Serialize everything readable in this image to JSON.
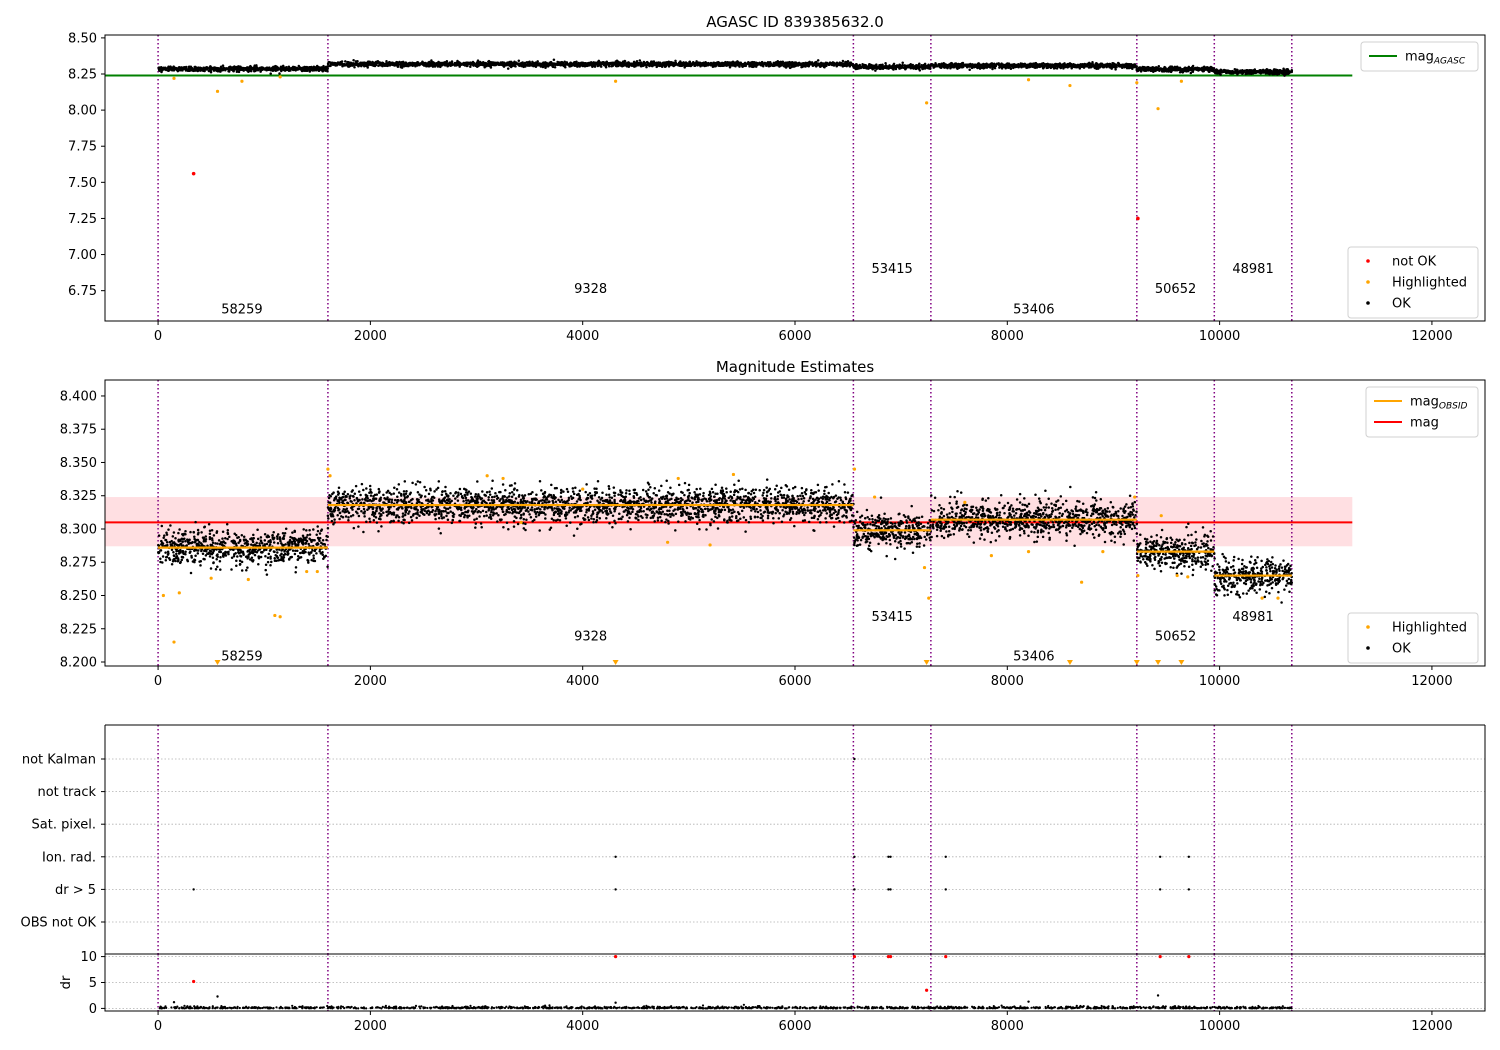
{
  "figure": {
    "title_top": "AGASC ID 839385632.0",
    "title_middle": "Magnitude Estimates"
  },
  "colors": {
    "ok": "#000000",
    "highlighted": "#ffa500",
    "not_ok": "#ff0000",
    "mag_agasc": "#008000",
    "mag": "#ff0000",
    "mag_obsid": "#ffa500",
    "band": "#ffc0c5",
    "obs_boundary": "#800080",
    "grid": "#b0b0b0"
  },
  "legends": {
    "top_upper": [
      {
        "label": "mag",
        "sub": "AGASC",
        "kind": "line",
        "color_key": "mag_agasc"
      }
    ],
    "top_lower": [
      {
        "label": "not OK",
        "kind": "dot",
        "color_key": "not_ok"
      },
      {
        "label": "Highlighted",
        "kind": "dot",
        "color_key": "highlighted"
      },
      {
        "label": "OK",
        "kind": "dot",
        "color_key": "ok"
      }
    ],
    "middle_upper": [
      {
        "label": "mag",
        "sub": "OBSID",
        "kind": "line",
        "color_key": "mag_obsid"
      },
      {
        "label": "mag",
        "sub": "",
        "kind": "line",
        "color_key": "mag"
      }
    ],
    "middle_lower": [
      {
        "label": "Highlighted",
        "kind": "dot",
        "color_key": "highlighted"
      },
      {
        "label": "OK",
        "kind": "dot",
        "color_key": "ok"
      }
    ]
  },
  "chart_data": [
    {
      "panel": "top",
      "type": "scatter",
      "title": "AGASC ID 839385632.0",
      "xlim": [
        -500,
        12500
      ],
      "ylim": [
        6.54,
        8.52
      ],
      "x_ticks": [
        0,
        2000,
        4000,
        6000,
        8000,
        10000,
        12000
      ],
      "x_tick_labels": [
        "0",
        "2000",
        "4000",
        "6000",
        "8000",
        "10000",
        "12000"
      ],
      "y_ticks": [
        6.75,
        7.0,
        7.25,
        7.5,
        7.75,
        8.0,
        8.25,
        8.5
      ],
      "y_tick_labels": [
        "6.75",
        "7.00",
        "7.25",
        "7.50",
        "7.75",
        "8.00",
        "8.25",
        "8.50"
      ],
      "obs_boundaries": [
        0,
        1600,
        6550,
        7280,
        9220,
        9950,
        10680
      ],
      "observations": [
        {
          "obsid": "58259",
          "x_start": 0,
          "x_end": 1600,
          "mag": 8.286,
          "label_x": 790,
          "label_y": 6.62
        },
        {
          "obsid": "9328",
          "x_start": 1600,
          "x_end": 6550,
          "mag": 8.318,
          "label_x": 4075,
          "label_y": 6.76
        },
        {
          "obsid": "53415",
          "x_start": 6550,
          "x_end": 7280,
          "mag": 8.299,
          "label_x": 6915,
          "label_y": 6.9
        },
        {
          "obsid": "53406",
          "x_start": 7280,
          "x_end": 9220,
          "mag": 8.307,
          "label_x": 8250,
          "label_y": 6.62
        },
        {
          "obsid": "50652",
          "x_start": 9220,
          "x_end": 9950,
          "mag": 8.283,
          "label_x": 9585,
          "label_y": 6.76
        },
        {
          "obsid": "48981",
          "x_start": 9950,
          "x_end": 10680,
          "mag": 8.265,
          "label_x": 10315,
          "label_y": 6.9
        }
      ],
      "mag_agasc": {
        "value": 8.24,
        "x_range": [
          -500,
          11250
        ]
      },
      "highlighted_points": [
        [
          150,
          8.22
        ],
        [
          560,
          8.13
        ],
        [
          790,
          8.2
        ],
        [
          1150,
          8.23
        ],
        [
          4310,
          8.2
        ],
        [
          7240,
          8.05
        ],
        [
          8200,
          8.21
        ],
        [
          8590,
          8.17
        ],
        [
          9220,
          8.19
        ],
        [
          9420,
          8.01
        ],
        [
          9640,
          8.2
        ]
      ],
      "not_ok_points": [
        [
          335,
          7.56
        ],
        [
          9230,
          7.25
        ]
      ]
    },
    {
      "panel": "middle",
      "type": "scatter",
      "title": "Magnitude Estimates",
      "xlim": [
        -500,
        12500
      ],
      "ylim": [
        8.197,
        8.412
      ],
      "x_ticks": [
        0,
        2000,
        4000,
        6000,
        8000,
        10000,
        12000
      ],
      "x_tick_labels": [
        "0",
        "2000",
        "4000",
        "6000",
        "8000",
        "10000",
        "12000"
      ],
      "y_ticks": [
        8.2,
        8.225,
        8.25,
        8.275,
        8.3,
        8.325,
        8.35,
        8.375,
        8.4
      ],
      "y_tick_labels": [
        "8.200",
        "8.225",
        "8.250",
        "8.275",
        "8.300",
        "8.325",
        "8.350",
        "8.375",
        "8.400"
      ],
      "obs_boundaries": [
        0,
        1600,
        6550,
        7280,
        9220,
        9950,
        10680
      ],
      "observations": [
        {
          "obsid": "58259",
          "x_start": 0,
          "x_end": 1600,
          "mag": 8.286,
          "spread": 0.0065,
          "label_x": 790,
          "label_y": 8.204
        },
        {
          "obsid": "9328",
          "x_start": 1600,
          "x_end": 6550,
          "mag": 8.318,
          "spread": 0.0065,
          "label_x": 4075,
          "label_y": 8.219
        },
        {
          "obsid": "53415",
          "x_start": 6550,
          "x_end": 7280,
          "mag": 8.299,
          "spread": 0.0065,
          "label_x": 6915,
          "label_y": 8.234
        },
        {
          "obsid": "53406",
          "x_start": 7280,
          "x_end": 9220,
          "mag": 8.307,
          "spread": 0.0065,
          "label_x": 8250,
          "label_y": 8.204
        },
        {
          "obsid": "50652",
          "x_start": 9220,
          "x_end": 9950,
          "mag": 8.283,
          "spread": 0.0065,
          "label_x": 9585,
          "label_y": 8.219
        },
        {
          "obsid": "48981",
          "x_start": 9950,
          "x_end": 10680,
          "mag": 8.265,
          "spread": 0.0065,
          "label_x": 10315,
          "label_y": 8.234
        }
      ],
      "mag": {
        "value": 8.305,
        "band": [
          8.287,
          8.324
        ],
        "x_range": [
          -500,
          11250
        ]
      },
      "highlighted_points": [
        [
          50,
          8.25
        ],
        [
          150,
          8.215
        ],
        [
          200,
          8.252
        ],
        [
          500,
          8.263
        ],
        [
          850,
          8.262
        ],
        [
          1100,
          8.235
        ],
        [
          1150,
          8.234
        ],
        [
          1400,
          8.268
        ],
        [
          1500,
          8.268
        ],
        [
          1600,
          8.345
        ],
        [
          1620,
          8.34
        ],
        [
          3100,
          8.34
        ],
        [
          3250,
          8.338
        ],
        [
          3420,
          8.305
        ],
        [
          4000,
          8.33
        ],
        [
          4800,
          8.29
        ],
        [
          4900,
          8.338
        ],
        [
          5200,
          8.288
        ],
        [
          5420,
          8.341
        ],
        [
          6560,
          8.345
        ],
        [
          6750,
          8.324
        ],
        [
          7220,
          8.271
        ],
        [
          7260,
          8.248
        ],
        [
          7600,
          8.32
        ],
        [
          7850,
          8.28
        ],
        [
          8200,
          8.283
        ],
        [
          8700,
          8.26
        ],
        [
          8900,
          8.283
        ],
        [
          9200,
          8.324
        ],
        [
          9230,
          8.265
        ],
        [
          9450,
          8.31
        ],
        [
          9600,
          8.265
        ],
        [
          9700,
          8.264
        ],
        [
          10400,
          8.248
        ],
        [
          10550,
          8.248
        ]
      ],
      "below_range_markers": [
        560,
        4310,
        7240,
        8590,
        9220,
        9420,
        9640
      ]
    },
    {
      "panel": "flags",
      "type": "scatter",
      "xlim": [
        -500,
        12500
      ],
      "categories": [
        "not Kalman",
        "not track",
        "Sat. pixel.",
        "Ion. rad.",
        "dr > 5",
        "OBS not OK"
      ],
      "flag_points": {
        "not Kalman": [
          6560
        ],
        "not track": [],
        "Sat. pixel.": [],
        "Ion. rad.": [
          4310,
          6560,
          6880,
          6900,
          7420,
          9440,
          9710
        ],
        "dr > 5": [
          335,
          4310,
          6560,
          6880,
          6900,
          7420,
          9440,
          9710
        ],
        "OBS not OK": []
      }
    },
    {
      "panel": "dr",
      "type": "scatter",
      "ylabel": "dr",
      "xlim": [
        -500,
        12500
      ],
      "ylim": [
        -0.5,
        10.5
      ],
      "x_ticks": [
        0,
        2000,
        4000,
        6000,
        8000,
        10000,
        12000
      ],
      "x_tick_labels": [
        "0",
        "2000",
        "4000",
        "6000",
        "8000",
        "10000",
        "12000"
      ],
      "y_ticks": [
        0,
        5,
        10
      ],
      "y_tick_labels": [
        "0",
        "5",
        "10"
      ],
      "not_ok_points": [
        [
          335,
          5.2
        ],
        [
          4310,
          10
        ],
        [
          6560,
          10
        ],
        [
          6880,
          10
        ],
        [
          6900,
          10
        ],
        [
          7240,
          3.5
        ],
        [
          7420,
          10
        ],
        [
          9440,
          10
        ],
        [
          9710,
          10
        ]
      ],
      "ok_outliers": [
        [
          150,
          1.2
        ],
        [
          560,
          2.3
        ],
        [
          4310,
          1.1
        ],
        [
          8200,
          1.3
        ],
        [
          9420,
          2.5
        ]
      ]
    }
  ]
}
